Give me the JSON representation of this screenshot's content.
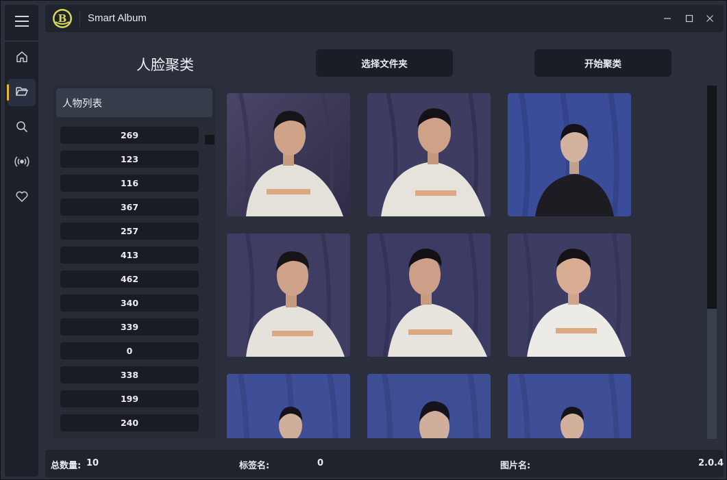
{
  "window": {
    "title": "Smart Album",
    "minimize_icon": "minimize-icon",
    "maximize_icon": "maximize-icon",
    "close_icon": "close-icon"
  },
  "nav": {
    "items": [
      {
        "icon": "menu-icon"
      },
      {
        "icon": "home-icon"
      },
      {
        "icon": "folder-icon",
        "active": true
      },
      {
        "icon": "search-icon"
      },
      {
        "icon": "broadcast-icon"
      },
      {
        "icon": "heart-icon"
      }
    ],
    "accent_color": "#f0b429"
  },
  "page": {
    "title": "人脸聚类",
    "select_folder_label": "选择文件夹",
    "start_cluster_label": "开始聚类"
  },
  "person_list": {
    "header": "人物列表",
    "items": [
      "269",
      "123",
      "116",
      "367",
      "257",
      "413",
      "462",
      "340",
      "339",
      "0",
      "338",
      "199",
      "240"
    ]
  },
  "photos": {
    "count_visible": 9
  },
  "status": {
    "total_label": "总数量:",
    "total_value": "10",
    "tag_label": "标签名:",
    "tag_value": "0",
    "image_label": "图片名:",
    "image_value": "",
    "version": "2.0.4"
  }
}
